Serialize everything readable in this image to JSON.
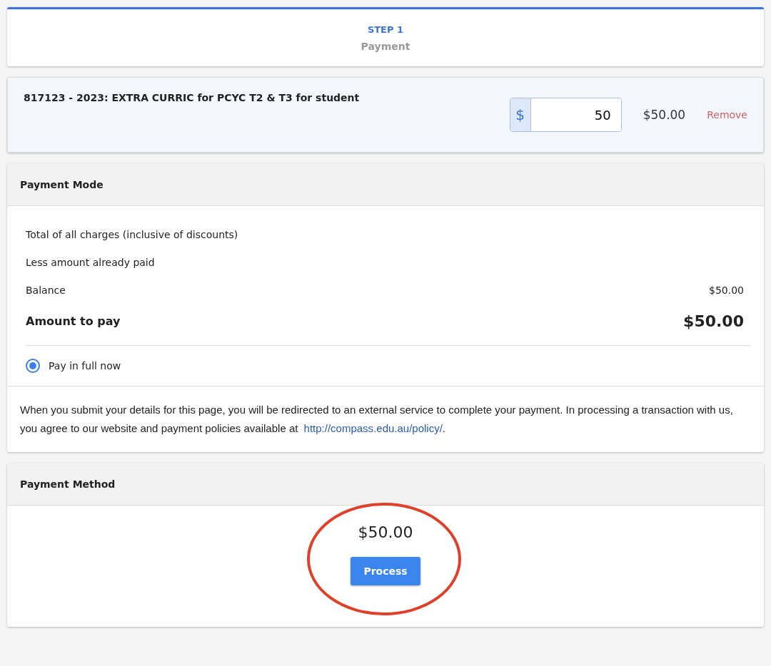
{
  "step": {
    "number": "STEP 1",
    "title": "Payment"
  },
  "item": {
    "description": "817123 - 2023: EXTRA CURRIC for PCYC T2 & T3 for student",
    "currency": "$",
    "amount": "50",
    "total": "$50.00",
    "remove": "Remove"
  },
  "payment_mode": {
    "title": "Payment Mode",
    "rows": [
      {
        "kind": "plain",
        "label": "Total of all charges (inclusive of discounts)"
      },
      {
        "kind": "plain",
        "label": "Less amount already paid"
      },
      {
        "kind": "plain",
        "label": "Balance",
        "value": "$50.00"
      },
      {
        "kind": "total",
        "label": "Amount to pay",
        "value": "$50.00"
      }
    ],
    "options": [
      {
        "label": "Pay in full now",
        "selected": true
      }
    ],
    "notice": {
      "text": "When you submit your details for this page, you will be redirected to an external service to complete your payment. In processing a transaction with us, you agree to our website and payment policies available at ",
      "link": "http://compass.edu.au/policy/",
      "tail": "."
    }
  },
  "payment_method": {
    "title": "Payment Method",
    "amount": "$50.00",
    "button": "Process"
  }
}
